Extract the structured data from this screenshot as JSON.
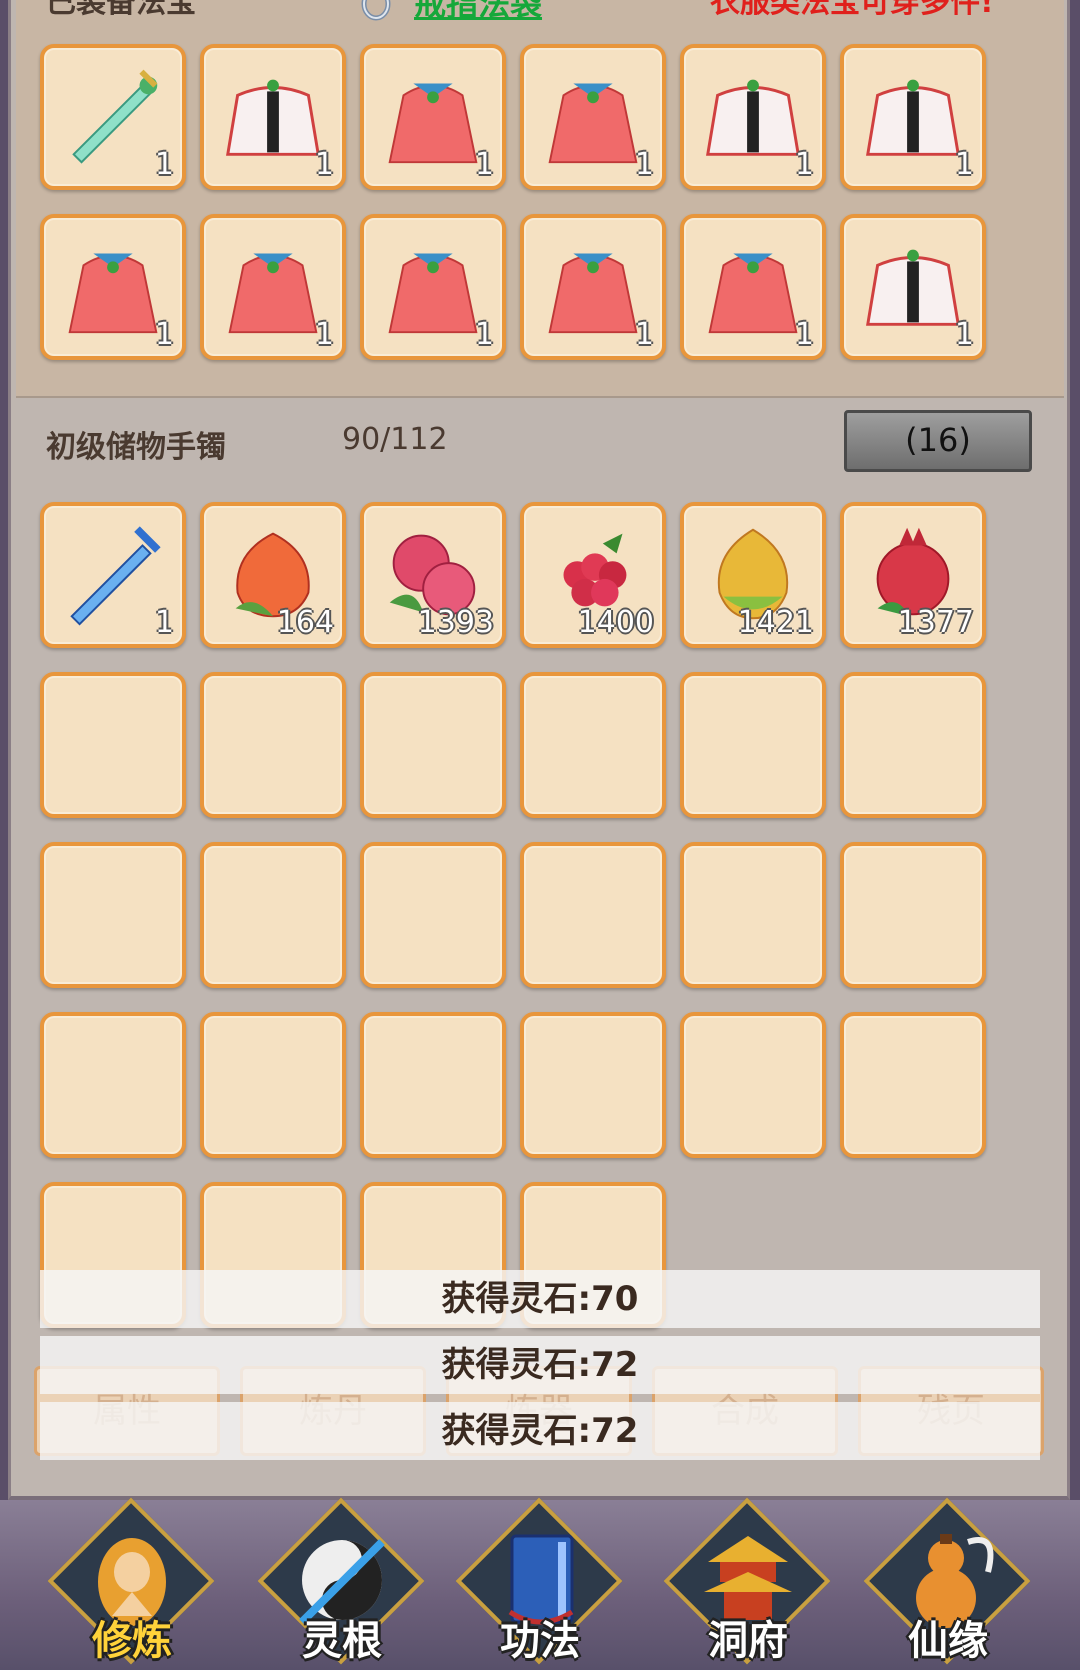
{
  "equip_header": {
    "title": "已装备法宝",
    "ring_link": "戒指法袋",
    "promo": "衣服类法宝可穿多件!"
  },
  "equipped": [
    {
      "icon": "green-sword-icon",
      "qty": "1"
    },
    {
      "icon": "white-red-robe-icon",
      "qty": "1"
    },
    {
      "icon": "red-robe-icon",
      "qty": "1"
    },
    {
      "icon": "red-robe-icon",
      "qty": "1"
    },
    {
      "icon": "white-red-robe-icon",
      "qty": "1"
    },
    {
      "icon": "white-red-robe-icon",
      "qty": "1"
    },
    {
      "icon": "red-robe-icon",
      "qty": "1"
    },
    {
      "icon": "red-robe-icon",
      "qty": "1"
    },
    {
      "icon": "red-robe-icon",
      "qty": "1"
    },
    {
      "icon": "red-robe-icon",
      "qty": "1"
    },
    {
      "icon": "red-robe-icon",
      "qty": "1"
    },
    {
      "icon": "white-red-robe-icon",
      "qty": "1"
    }
  ],
  "storage": {
    "label": "初级储物手镯",
    "count": "90/112",
    "page_button": "(16)"
  },
  "storage_items": [
    {
      "icon": "blue-sword-icon",
      "qty": "1"
    },
    {
      "icon": "peach-icon",
      "qty": "164"
    },
    {
      "icon": "pink-fruit-icon",
      "qty": "1393"
    },
    {
      "icon": "berry-icon",
      "qty": "1400"
    },
    {
      "icon": "golden-fruit-icon",
      "qty": "1421"
    },
    {
      "icon": "pomegranate-icon",
      "qty": "1377"
    }
  ],
  "tabs": [
    "属性",
    "炼丹",
    "炼器",
    "合成",
    "残页"
  ],
  "toasts": [
    "获得灵石:70",
    "获得灵石:72",
    "获得灵石:72"
  ],
  "nav": [
    {
      "label": "修炼",
      "icon": "cultivation-monk-icon",
      "active": true
    },
    {
      "label": "灵根",
      "icon": "yin-yang-sword-icon",
      "active": false
    },
    {
      "label": "功法",
      "icon": "book-icon",
      "active": false
    },
    {
      "label": "洞府",
      "icon": "pagoda-icon",
      "active": false
    },
    {
      "label": "仙缘",
      "icon": "gourd-icon",
      "active": false
    }
  ],
  "colors": {
    "slot_bg": "#f5e1c2",
    "slot_border": "#e8963c",
    "link_green": "#15a83a",
    "promo_red": "#e0201c",
    "nav_active": "#ffd23a"
  }
}
